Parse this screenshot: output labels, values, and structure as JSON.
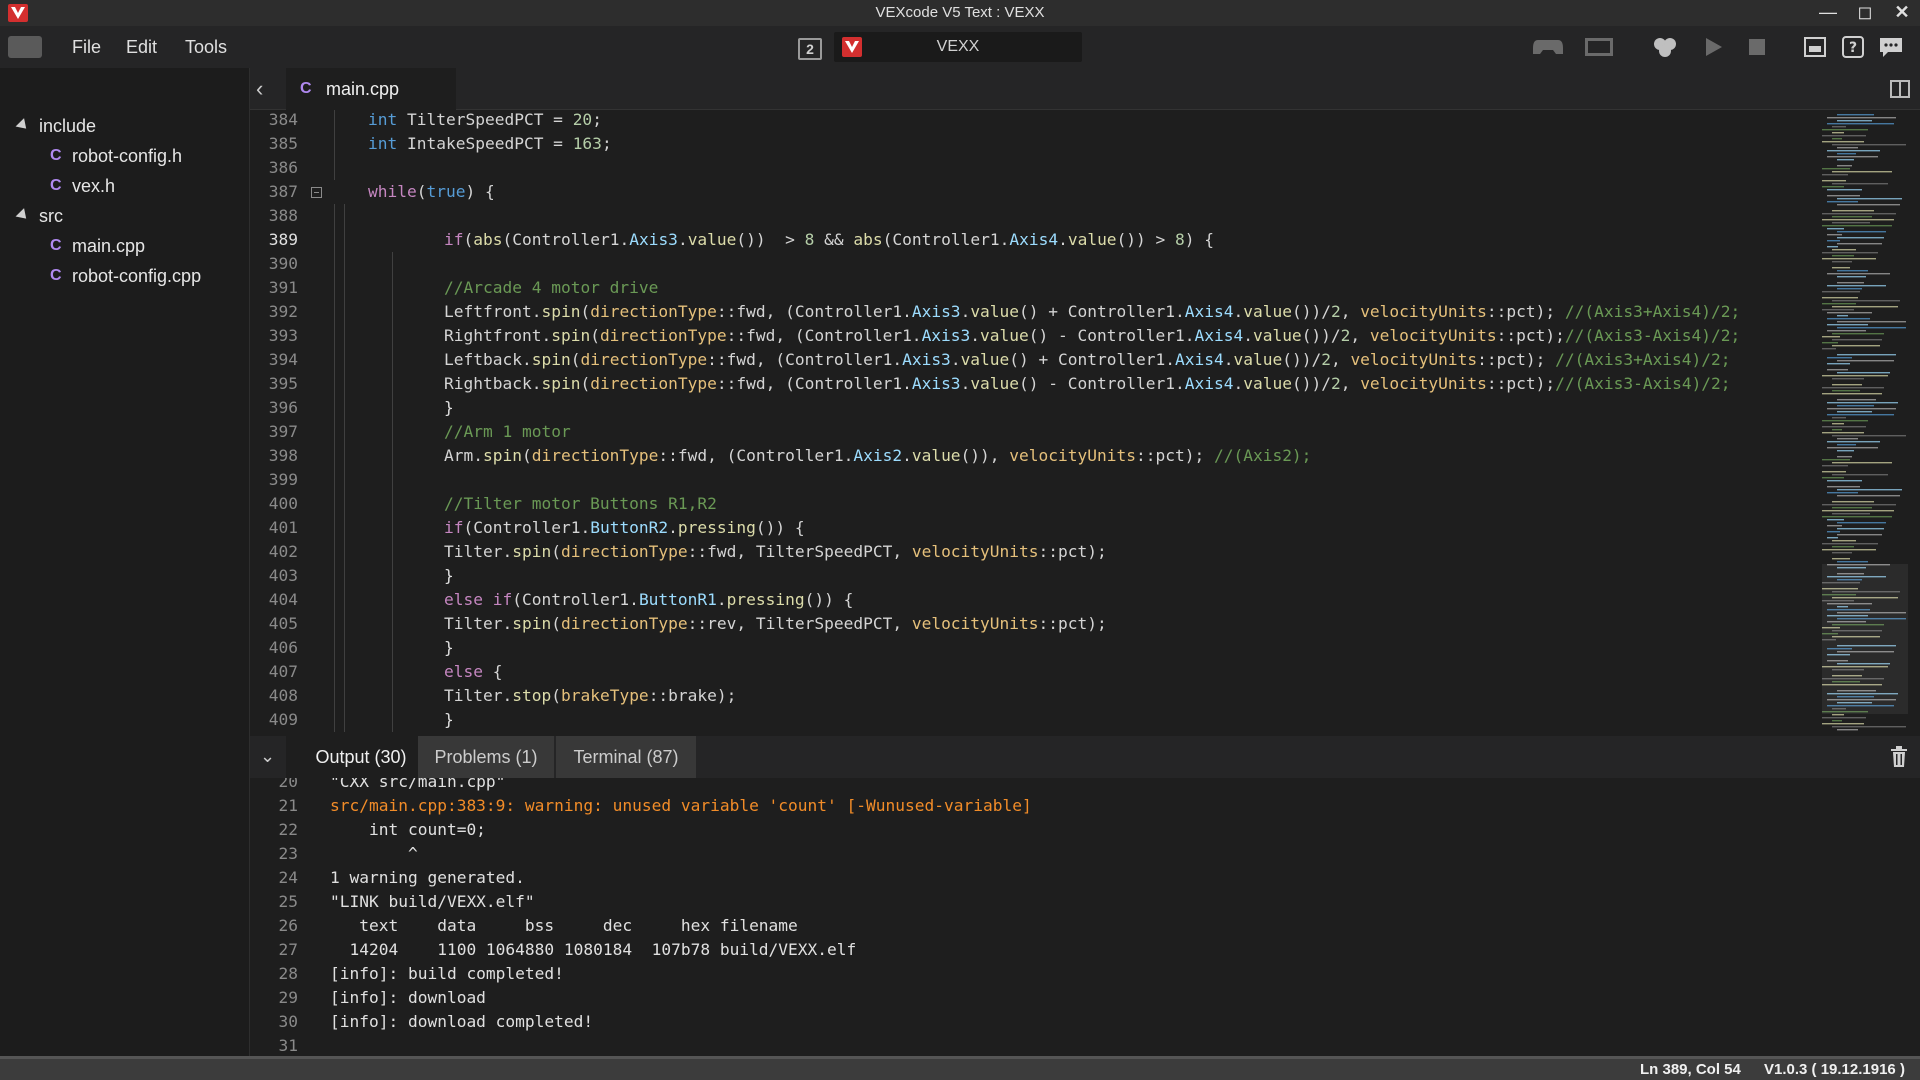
{
  "window": {
    "title": "VEXcode V5 Text : VEXX",
    "colors": {
      "brand": "#d32f2f",
      "accent": "#b089f0"
    }
  },
  "menubar": {
    "items": [
      "File",
      "Edit",
      "Tools"
    ],
    "slot": "2",
    "project": "VEXX"
  },
  "toolbar": {
    "icons": [
      "controller-icon",
      "brain-screen-icon",
      "build-download-icon",
      "play-icon",
      "stop-icon",
      "devices-icon",
      "help-icon",
      "feedback-icon"
    ]
  },
  "sidebar": {
    "folders": [
      {
        "name": "include",
        "files": [
          "robot-config.h",
          "vex.h"
        ]
      },
      {
        "name": "src",
        "files": [
          "main.cpp",
          "robot-config.cpp"
        ]
      }
    ]
  },
  "editor": {
    "tab": "main.cpp",
    "active_line": 389,
    "lines": [
      {
        "n": "384",
        "d": 1,
        "t": [
          [
            "int",
            "kw"
          ],
          [
            " TilterSpeedPCT = ",
            ""
          ],
          [
            "20",
            "nm"
          ],
          [
            ";",
            ""
          ]
        ]
      },
      {
        "n": "385",
        "d": 1,
        "t": [
          [
            "int",
            "kw"
          ],
          [
            " IntakeSpeedPCT = ",
            ""
          ],
          [
            "163",
            "nm"
          ],
          [
            ";",
            ""
          ]
        ]
      },
      {
        "n": "386",
        "d": 1,
        "t": []
      },
      {
        "n": "387",
        "d": 1,
        "fold": true,
        "t": [
          [
            "while",
            "ctl"
          ],
          [
            "(",
            ""
          ],
          [
            "true",
            "kw"
          ],
          [
            ") {",
            ""
          ]
        ]
      },
      {
        "n": "388",
        "d": 2,
        "t": []
      },
      {
        "n": "389",
        "d": 2,
        "t": [
          [
            "if",
            "ctl"
          ],
          [
            "(",
            ""
          ],
          [
            "abs",
            "fn"
          ],
          [
            "(Controller1.",
            ""
          ],
          [
            "Axis3",
            "id"
          ],
          [
            ".",
            ""
          ],
          [
            "value",
            "fn"
          ],
          [
            "())  > ",
            ""
          ],
          [
            "8",
            "nm"
          ],
          [
            " && ",
            ""
          ],
          [
            "abs",
            "fn"
          ],
          [
            "(Controller1.",
            ""
          ],
          [
            "Axis4",
            "id"
          ],
          [
            ".",
            ""
          ],
          [
            "value",
            "fn"
          ],
          [
            "()) > ",
            ""
          ],
          [
            "8",
            "nm"
          ],
          [
            ") {",
            ""
          ]
        ]
      },
      {
        "n": "390",
        "d": 3,
        "t": []
      },
      {
        "n": "391",
        "d": 3,
        "t": [
          [
            "//Arcade 4 motor drive",
            "cm"
          ]
        ]
      },
      {
        "n": "392",
        "d": 3,
        "t": [
          [
            "Leftfront.",
            ""
          ],
          [
            "spin",
            "fn"
          ],
          [
            "(",
            ""
          ],
          [
            "directionType",
            "tp"
          ],
          [
            "::fwd, (Controller1.",
            ""
          ],
          [
            "Axis3",
            "id"
          ],
          [
            ".",
            ""
          ],
          [
            "value",
            "fn"
          ],
          [
            "() + Controller1.",
            ""
          ],
          [
            "Axis4",
            "id"
          ],
          [
            ".",
            ""
          ],
          [
            "value",
            "fn"
          ],
          [
            "())/",
            ""
          ],
          [
            "2",
            "nm"
          ],
          [
            ", ",
            ""
          ],
          [
            "velocityUnits",
            "tp"
          ],
          [
            "::pct); ",
            ""
          ],
          [
            "//(Axis3+Axis4)/2;",
            "cm"
          ]
        ]
      },
      {
        "n": "393",
        "d": 3,
        "t": [
          [
            "Rightfront.",
            ""
          ],
          [
            "spin",
            "fn"
          ],
          [
            "(",
            ""
          ],
          [
            "directionType",
            "tp"
          ],
          [
            "::fwd, (Controller1.",
            ""
          ],
          [
            "Axis3",
            "id"
          ],
          [
            ".",
            ""
          ],
          [
            "value",
            "fn"
          ],
          [
            "() - Controller1.",
            ""
          ],
          [
            "Axis4",
            "id"
          ],
          [
            ".",
            ""
          ],
          [
            "value",
            "fn"
          ],
          [
            "())/",
            ""
          ],
          [
            "2",
            "nm"
          ],
          [
            ", ",
            ""
          ],
          [
            "velocityUnits",
            "tp"
          ],
          [
            "::pct);",
            ""
          ],
          [
            "//(Axis3-Axis4)/2;",
            "cm"
          ]
        ]
      },
      {
        "n": "394",
        "d": 3,
        "t": [
          [
            "Leftback.",
            ""
          ],
          [
            "spin",
            "fn"
          ],
          [
            "(",
            ""
          ],
          [
            "directionType",
            "tp"
          ],
          [
            "::fwd, (Controller1.",
            ""
          ],
          [
            "Axis3",
            "id"
          ],
          [
            ".",
            ""
          ],
          [
            "value",
            "fn"
          ],
          [
            "() + Controller1.",
            ""
          ],
          [
            "Axis4",
            "id"
          ],
          [
            ".",
            ""
          ],
          [
            "value",
            "fn"
          ],
          [
            "())/",
            ""
          ],
          [
            "2",
            "nm"
          ],
          [
            ", ",
            ""
          ],
          [
            "velocityUnits",
            "tp"
          ],
          [
            "::pct); ",
            ""
          ],
          [
            "//(Axis3+Axis4)/2;",
            "cm"
          ]
        ]
      },
      {
        "n": "395",
        "d": 3,
        "t": [
          [
            "Rightback.",
            ""
          ],
          [
            "spin",
            "fn"
          ],
          [
            "(",
            ""
          ],
          [
            "directionType",
            "tp"
          ],
          [
            "::fwd, (Controller1.",
            ""
          ],
          [
            "Axis3",
            "id"
          ],
          [
            ".",
            ""
          ],
          [
            "value",
            "fn"
          ],
          [
            "() - Controller1.",
            ""
          ],
          [
            "Axis4",
            "id"
          ],
          [
            ".",
            ""
          ],
          [
            "value",
            "fn"
          ],
          [
            "())/",
            ""
          ],
          [
            "2",
            "nm"
          ],
          [
            ", ",
            ""
          ],
          [
            "velocityUnits",
            "tp"
          ],
          [
            "::pct);",
            ""
          ],
          [
            "//(Axis3-Axis4)/2;",
            "cm"
          ]
        ]
      },
      {
        "n": "396",
        "d": 3,
        "t": [
          [
            "}",
            "br"
          ]
        ]
      },
      {
        "n": "397",
        "d": 3,
        "t": [
          [
            "//Arm 1 motor",
            "cm"
          ]
        ]
      },
      {
        "n": "398",
        "d": 3,
        "t": [
          [
            "Arm.",
            ""
          ],
          [
            "spin",
            "fn"
          ],
          [
            "(",
            ""
          ],
          [
            "directionType",
            "tp"
          ],
          [
            "::fwd, (Controller1.",
            ""
          ],
          [
            "Axis2",
            "id"
          ],
          [
            ".",
            ""
          ],
          [
            "value",
            "fn"
          ],
          [
            "()), ",
            ""
          ],
          [
            "velocityUnits",
            "tp"
          ],
          [
            "::pct); ",
            ""
          ],
          [
            "//(Axis2);",
            "cm"
          ]
        ]
      },
      {
        "n": "399",
        "d": 3,
        "t": []
      },
      {
        "n": "400",
        "d": 3,
        "t": [
          [
            "//Tilter motor Buttons R1,R2",
            "cm"
          ]
        ]
      },
      {
        "n": "401",
        "d": 3,
        "t": [
          [
            "if",
            "ctl"
          ],
          [
            "(Controller1.",
            ""
          ],
          [
            "ButtonR2",
            "id"
          ],
          [
            ".",
            ""
          ],
          [
            "pressing",
            "fn"
          ],
          [
            "()) {",
            ""
          ]
        ]
      },
      {
        "n": "402",
        "d": 3,
        "t": [
          [
            "Tilter.",
            ""
          ],
          [
            "spin",
            "fn"
          ],
          [
            "(",
            ""
          ],
          [
            "directionType",
            "tp"
          ],
          [
            "::fwd, TilterSpeedPCT, ",
            ""
          ],
          [
            "velocityUnits",
            "tp"
          ],
          [
            "::pct);",
            ""
          ]
        ]
      },
      {
        "n": "403",
        "d": 3,
        "t": [
          [
            "}",
            "br"
          ]
        ]
      },
      {
        "n": "404",
        "d": 3,
        "t": [
          [
            "else",
            "ctl"
          ],
          [
            " ",
            ""
          ],
          [
            "if",
            "ctl"
          ],
          [
            "(Controller1.",
            ""
          ],
          [
            "ButtonR1",
            "id"
          ],
          [
            ".",
            ""
          ],
          [
            "pressing",
            "fn"
          ],
          [
            "()) {",
            ""
          ]
        ]
      },
      {
        "n": "405",
        "d": 3,
        "t": [
          [
            "Tilter.",
            ""
          ],
          [
            "spin",
            "fn"
          ],
          [
            "(",
            ""
          ],
          [
            "directionType",
            "tp"
          ],
          [
            "::rev, TilterSpeedPCT, ",
            ""
          ],
          [
            "velocityUnits",
            "tp"
          ],
          [
            "::pct);",
            ""
          ]
        ]
      },
      {
        "n": "406",
        "d": 3,
        "t": [
          [
            "}",
            "br"
          ]
        ]
      },
      {
        "n": "407",
        "d": 3,
        "t": [
          [
            "else",
            "ctl"
          ],
          [
            " {",
            ""
          ]
        ]
      },
      {
        "n": "408",
        "d": 3,
        "t": [
          [
            "Tilter.",
            ""
          ],
          [
            "stop",
            "fn"
          ],
          [
            "(",
            ""
          ],
          [
            "brakeType",
            "tp"
          ],
          [
            "::brake);",
            ""
          ]
        ]
      },
      {
        "n": "409",
        "d": 3,
        "t": [
          [
            "}",
            "br"
          ]
        ]
      }
    ]
  },
  "panel": {
    "tabs": [
      {
        "label": "Output (30)",
        "active": true
      },
      {
        "label": "Problems (1)",
        "active": false
      },
      {
        "label": "Terminal (87)",
        "active": false
      }
    ],
    "output": [
      {
        "n": "20",
        "text": "\"CXX src/main.cpp\""
      },
      {
        "n": "21",
        "text": "src/main.cpp:383:9: warning: unused variable 'count' [-Wunused-variable]",
        "warn": true
      },
      {
        "n": "22",
        "text": "    int count=0;"
      },
      {
        "n": "23",
        "text": "        ^"
      },
      {
        "n": "24",
        "text": "1 warning generated."
      },
      {
        "n": "25",
        "text": "\"LINK build/VEXX.elf\""
      },
      {
        "n": "26",
        "text": "   text    data     bss     dec     hex filename"
      },
      {
        "n": "27",
        "text": "  14204    1100 1064880 1080184  107b78 build/VEXX.elf"
      },
      {
        "n": "28",
        "text": "[info]: build completed!"
      },
      {
        "n": "29",
        "text": "[info]: download"
      },
      {
        "n": "30",
        "text": "[info]: download completed!"
      },
      {
        "n": "31",
        "text": ""
      }
    ]
  },
  "status": {
    "position": "Ln 389, Col 54",
    "version": "V1.0.3 ( 19.12.1916 )"
  }
}
